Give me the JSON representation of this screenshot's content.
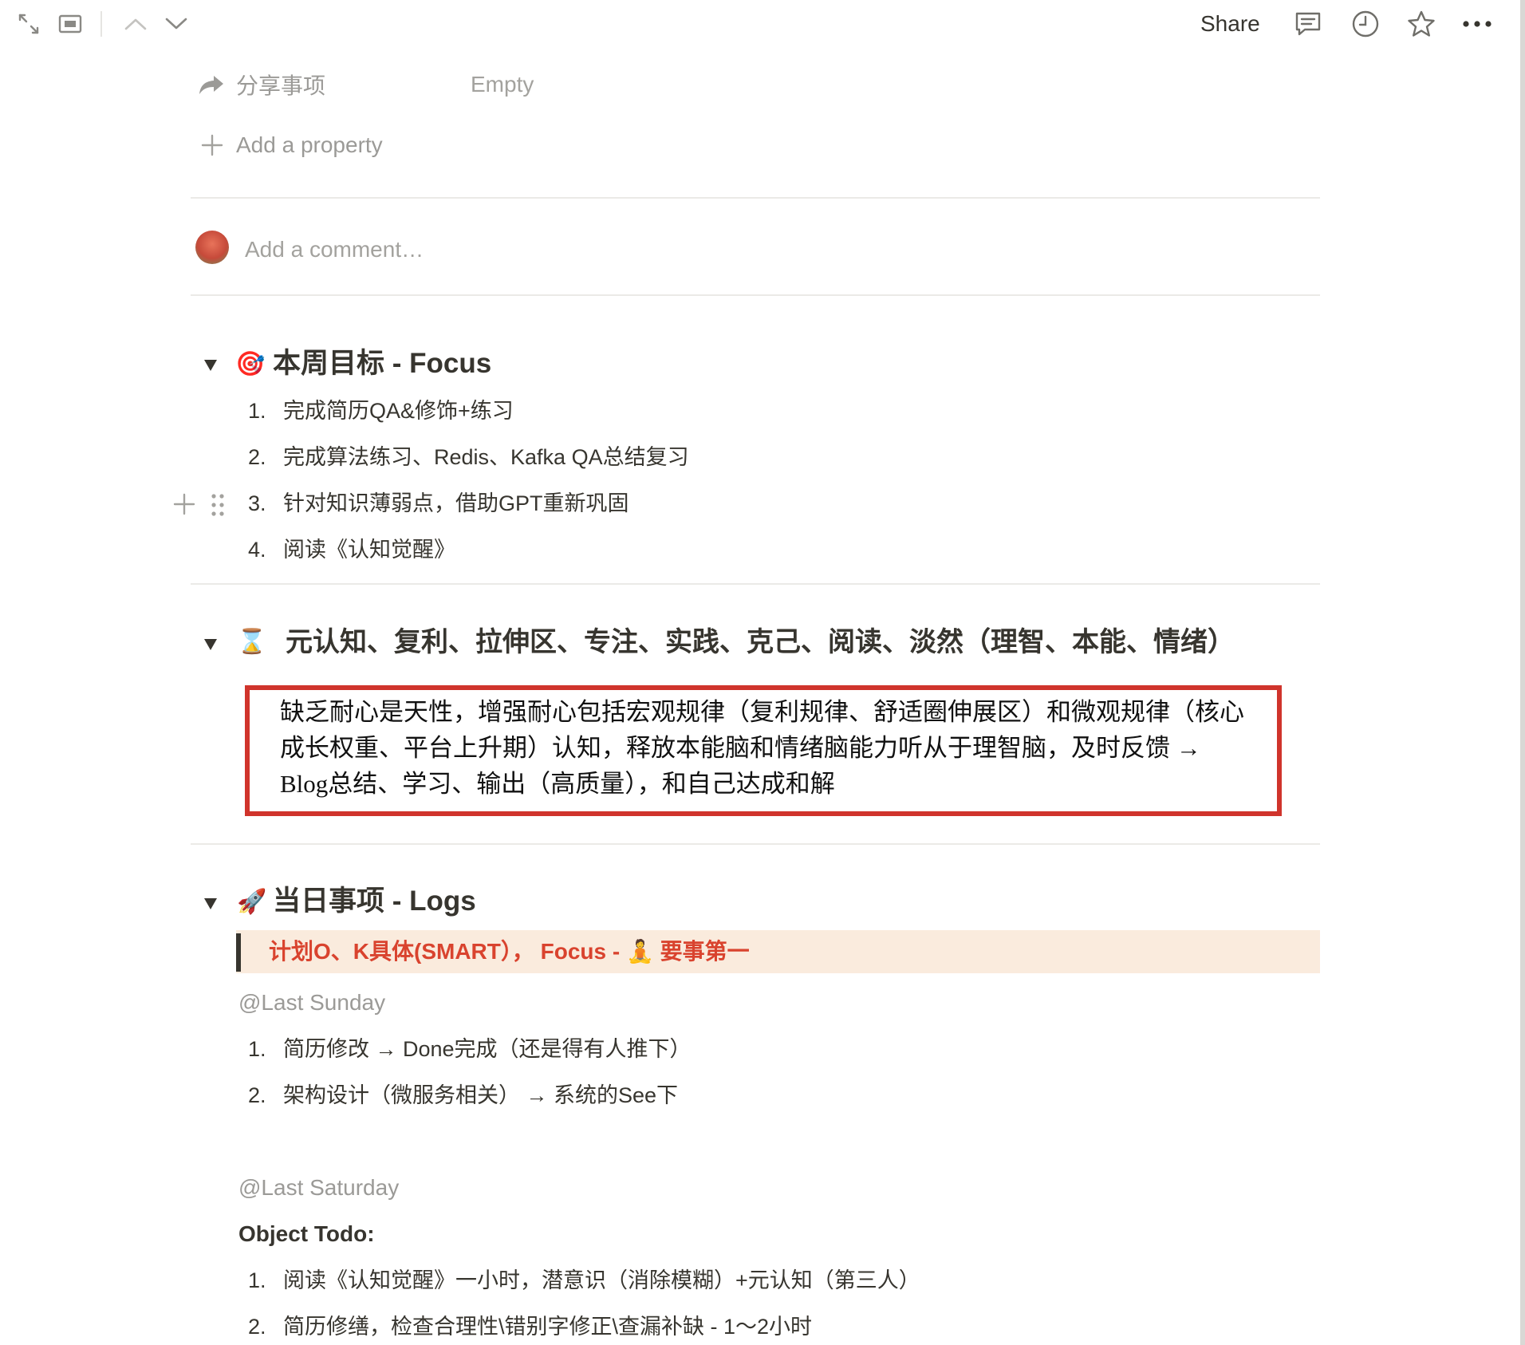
{
  "toolbar": {
    "share_label": "Share"
  },
  "properties": {
    "share_item_label": "分享事项",
    "share_item_value": "Empty",
    "add_property_label": "Add a property"
  },
  "comment": {
    "placeholder": "Add a comment…"
  },
  "sections": {
    "focus": {
      "emoji": "🎯",
      "title": "本周目标 - Focus",
      "items": [
        "完成简历QA&修饰+练习",
        "完成算法练习、Redis、Kafka QA总结复习",
        "针对知识薄弱点，借助GPT重新巩固",
        "阅读《认知觉醒》"
      ]
    },
    "principles": {
      "emoji": "⌛",
      "title": "元认知、复利、拉伸区、专注、实践、克己、阅读、淡然（理智、本能、情绪）",
      "quote_lines": [
        "缺乏耐心是天性，增强耐心包括宏观规律（复利规律、舒适圈伸展区）和微观规律（核心",
        "成长权重、平台上升期）认知，释放本能脑和情绪脑能力听从于理智脑，及时反馈 →",
        "Blog总结、学习、输出（高质量），和自己达成和解"
      ]
    },
    "logs": {
      "emoji": "🚀",
      "title": "当日事项 - Logs",
      "callout": "计划O、K具体(SMART），  Focus - 🧘 要事第一",
      "sunday_mention": "@Last Sunday",
      "sunday_items": [
        "简历修改 → Done完成（还是得有人推下）",
        "架构设计（微服务相关）  → 系统的See下"
      ],
      "saturday_mention": "@Last Saturday",
      "object_todo_label": "Object Todo:",
      "saturday_items": [
        "阅读《认知觉醒》一小时，潜意识（消除模糊）+元认知（第三人）",
        "简历修缮，检查合理性\\错别字修正\\查漏补缺 - 1～2小时"
      ]
    }
  },
  "list_numbers": [
    "1.",
    "2.",
    "3.",
    "4."
  ],
  "colors": {
    "text": "#37352f",
    "muted": "#9b9a97",
    "red_border": "#d0342c",
    "callout_bg": "#faebdd",
    "callout_text": "#d9432e"
  }
}
